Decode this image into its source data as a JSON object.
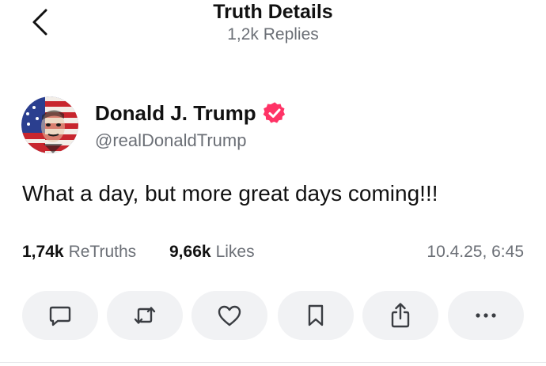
{
  "header": {
    "title": "Truth Details",
    "subtitle": "1,2k Replies"
  },
  "post": {
    "author": {
      "display_name": "Donald J. Trump",
      "handle": "@realDonaldTrump",
      "verified": true,
      "verified_color": "#ff3366"
    },
    "text": "What a day, but more great days coming!!!",
    "stats": {
      "retruths_count": "1,74k",
      "retruths_label": "ReTruths",
      "likes_count": "9,66k",
      "likes_label": "Likes"
    },
    "timestamp": "10.4.25, 6:45"
  },
  "actions": [
    {
      "icon": "reply-icon"
    },
    {
      "icon": "retruth-icon"
    },
    {
      "icon": "heart-icon"
    },
    {
      "icon": "bookmark-icon"
    },
    {
      "icon": "share-icon"
    },
    {
      "icon": "more-icon"
    }
  ],
  "colors": {
    "text_primary": "#111111",
    "text_secondary": "#6b6f76",
    "button_bg": "#f1f2f4",
    "icon": "#3a3d42"
  }
}
